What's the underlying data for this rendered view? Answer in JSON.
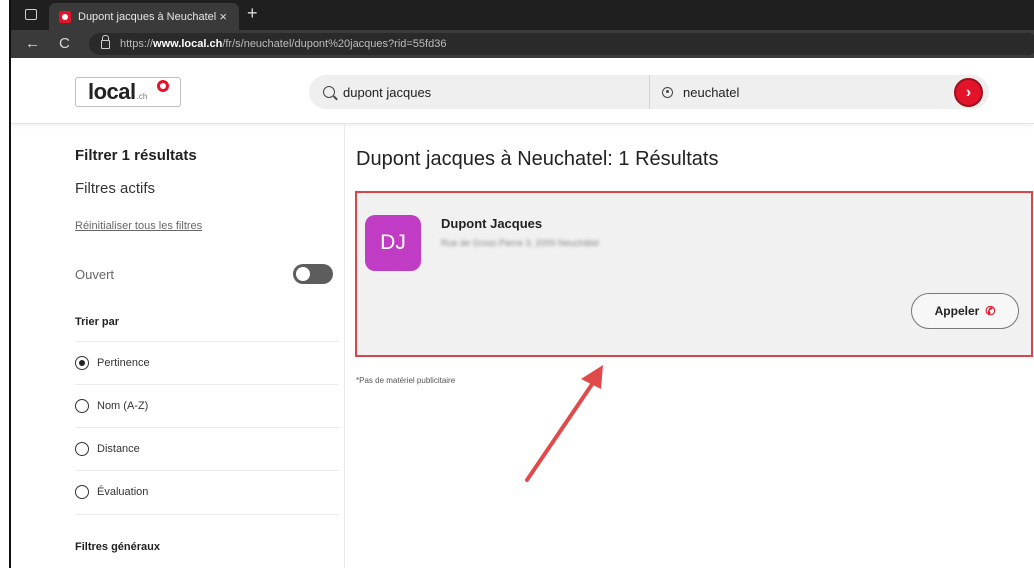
{
  "browser": {
    "tab_title": "Dupont jacques à Neuchatel – Tr",
    "tab_close": "×",
    "new_tab": "+",
    "back": "←",
    "reload": "C",
    "url_prefix": "https://",
    "url_domain": "www.local.ch",
    "url_path": "/fr/s/neuchatel/dupont%20jacques?rid=55fd36"
  },
  "header": {
    "logo_text": "local",
    "logo_suffix": ".ch",
    "search_value": "dupont jacques",
    "location_value": "neuchatel",
    "submit_symbol": "›",
    "brand_color": "#e3132a"
  },
  "sidebar": {
    "filter_title": "Filtrer 1 résultats",
    "active_filters": "Filtres actifs",
    "reset_label": "Réinitialiser tous les filtres",
    "open_label": "Ouvert",
    "open_toggle_on": false,
    "sort_title": "Trier par",
    "sort_options": [
      {
        "label": "Pertinence",
        "checked": true
      },
      {
        "label": "Nom (A-Z)",
        "checked": false
      },
      {
        "label": "Distance",
        "checked": false
      },
      {
        "label": "Évaluation",
        "checked": false
      }
    ],
    "general_title": "Filtres généraux"
  },
  "results": {
    "title": "Dupont jacques à Neuchatel: 1 Résultats",
    "items": [
      {
        "initials": "DJ",
        "name": "Dupont Jacques",
        "address": "Rue de Gross Pierre 3, 2000 Neuchâtel",
        "call_label": "Appeler",
        "call_icon": "phone-icon"
      }
    ],
    "ad_note": "*Pas de matériel publicitaire"
  },
  "annotation": {
    "highlight_color": "#d9454a",
    "arrow_color": "#e04a4a"
  }
}
